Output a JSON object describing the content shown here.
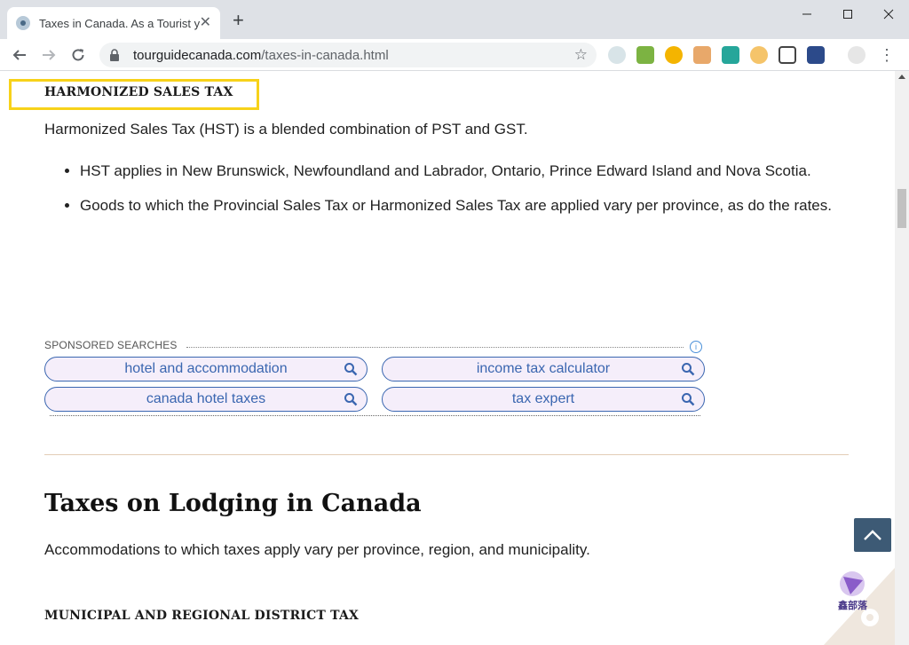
{
  "browser": {
    "tab_title": "Taxes in Canada. As a Tourist y",
    "url_domain": "tourguidecanada.com",
    "url_path": "/taxes-in-canada.html"
  },
  "content": {
    "hst_heading": "HARMONIZED SALES TAX",
    "hst_intro": "Harmonized Sales Tax (HST) is a blended combination of PST and GST.",
    "hst_bullets": [
      "HST applies in New Brunswick, Newfoundland and Labrador, Ontario, Prince Edward Island and Nova Scotia.",
      "Goods to which the Provincial Sales Tax or Harmonized Sales Tax are applied vary per province, as do the rates."
    ],
    "lodging_heading": "Taxes on Lodging in Canada",
    "lodging_intro": "Accommodations to which taxes apply vary per province, region, and municipality.",
    "municipal_heading": "MUNICIPAL AND REGIONAL DISTRICT TAX"
  },
  "sponsored": {
    "label": "SPONSORED SEARCHES",
    "searches": [
      "hotel and accommodation",
      "income tax calculator",
      "canada hotel taxes",
      "tax expert"
    ]
  },
  "watermark": {
    "text": "鑫部落"
  },
  "colors": {
    "highlight": "#f7d21a",
    "pill_border": "#3a66b0",
    "pill_bg": "#f5eefa",
    "back_to_top": "#3d5a75",
    "divider": "#e3cdb6"
  }
}
